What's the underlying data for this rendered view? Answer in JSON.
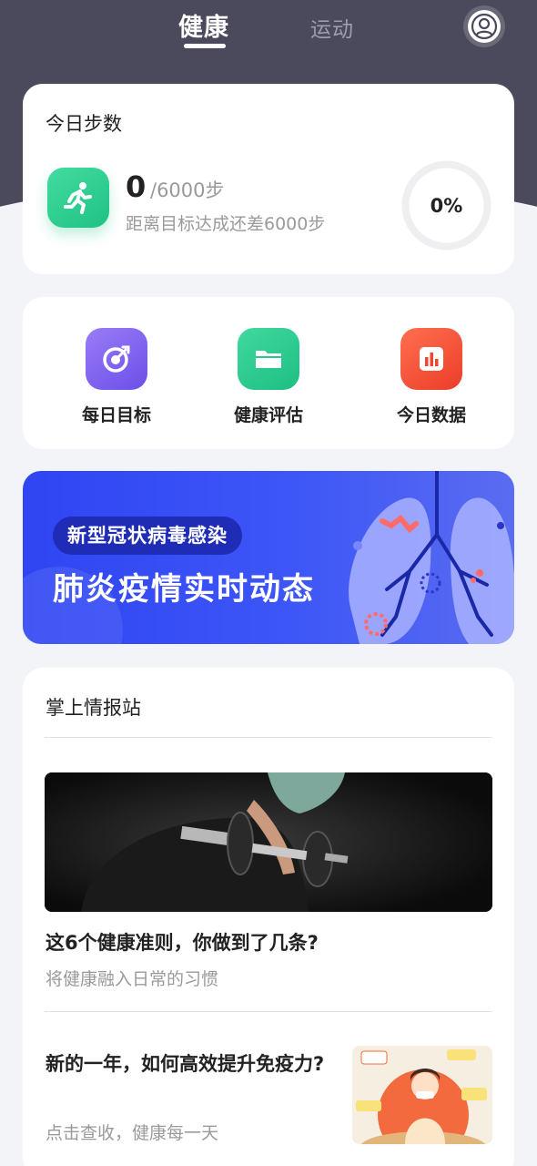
{
  "header": {
    "tabs": [
      {
        "label": "健康",
        "active": true
      },
      {
        "label": "运动",
        "active": false
      }
    ],
    "avatar_icon": "user-avatar-icon"
  },
  "steps": {
    "title": "今日步数",
    "value": "0",
    "goal": "/6000步",
    "remaining": "距离目标达成还差6000步",
    "progress_label": "0%",
    "progress": 0
  },
  "shortcuts": [
    {
      "label": "每日目标",
      "icon": "target-icon",
      "color": "#7b5cf0"
    },
    {
      "label": "健康评估",
      "icon": "folder-icon",
      "color": "#2cc98c"
    },
    {
      "label": "今日数据",
      "icon": "bar-chart-icon",
      "color": "#f24a33"
    }
  ],
  "banner": {
    "tag": "新型冠状病毒感染",
    "headline": "肺炎疫情实时动态"
  },
  "news": {
    "section_title": "掌上情报站",
    "articles": [
      {
        "title": "这6个健康准则，你做到了几条?",
        "subtitle": "将健康融入日常的习惯"
      },
      {
        "title": "新的一年，如何高效提升免疫力?",
        "subtitle": "点击查收，健康每一天"
      }
    ]
  },
  "colors": {
    "header_bg": "#4b4a5c",
    "accent_green": "#2cc98c",
    "banner_blue": "#3048f2"
  }
}
